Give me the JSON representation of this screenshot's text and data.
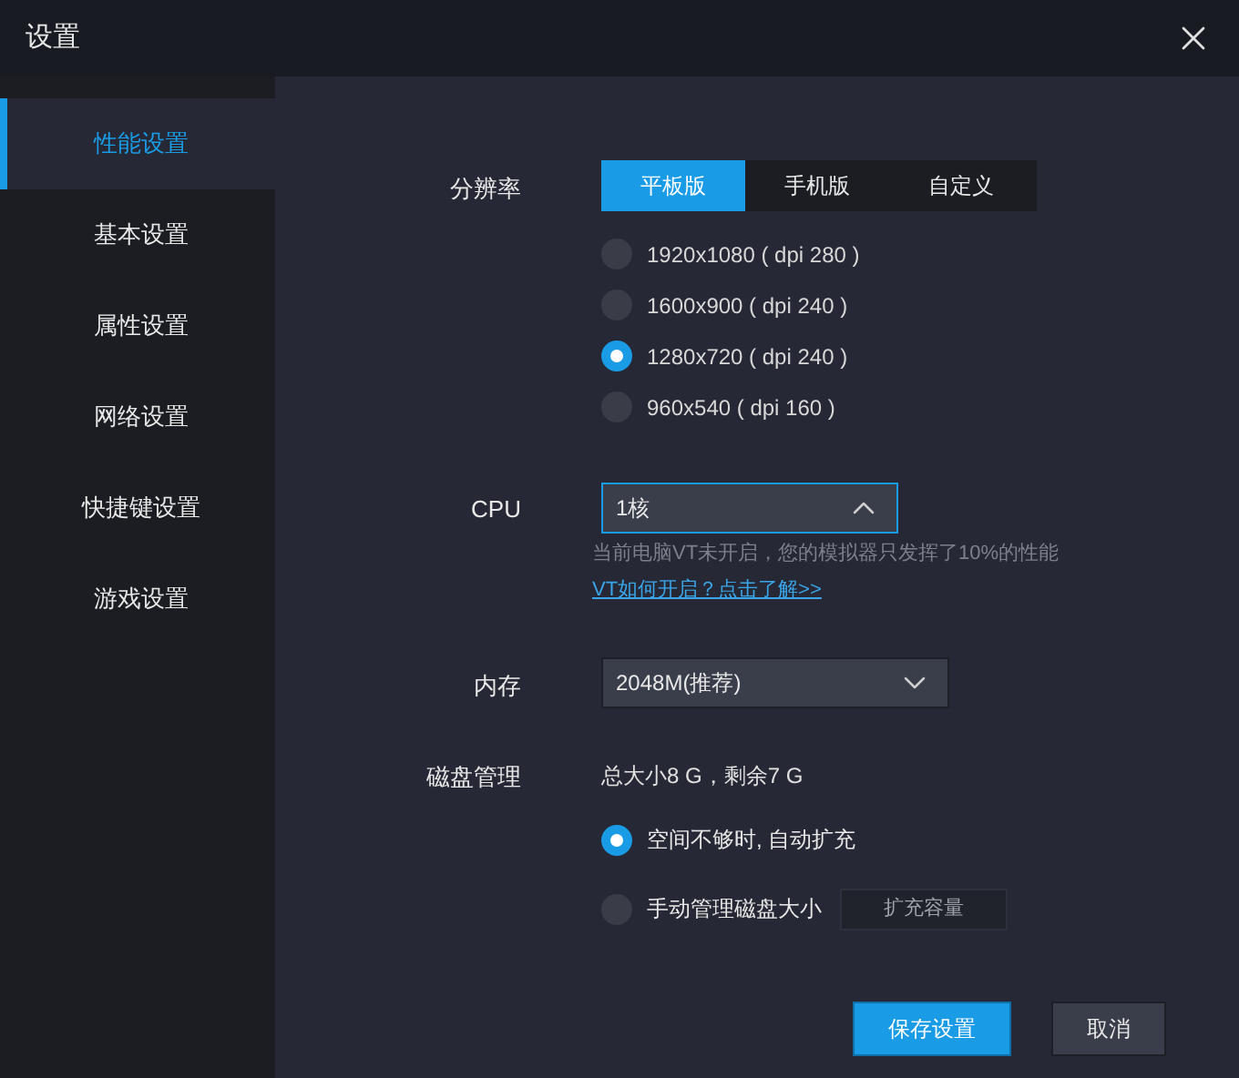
{
  "window": {
    "title": "设置"
  },
  "sidebar": {
    "items": [
      {
        "label": "性能设置",
        "selected": true
      },
      {
        "label": "基本设置",
        "selected": false
      },
      {
        "label": "属性设置",
        "selected": false
      },
      {
        "label": "网络设置",
        "selected": false
      },
      {
        "label": "快捷键设置",
        "selected": false
      },
      {
        "label": "游戏设置",
        "selected": false
      }
    ]
  },
  "resolution": {
    "label": "分辨率",
    "tabs": [
      {
        "label": "平板版",
        "selected": true
      },
      {
        "label": "手机版",
        "selected": false
      },
      {
        "label": "自定义",
        "selected": false
      }
    ],
    "options": [
      {
        "label": "1920x1080 ( dpi 280 )",
        "selected": false
      },
      {
        "label": "1600x900 ( dpi 240 )",
        "selected": false
      },
      {
        "label": "1280x720 ( dpi 240 )",
        "selected": true
      },
      {
        "label": "960x540 ( dpi 160 )",
        "selected": false
      }
    ]
  },
  "cpu": {
    "label": "CPU",
    "value": "1核",
    "expanded": true,
    "hint": "当前电脑VT未开启，您的模拟器只发挥了10%的性能",
    "link": "VT如何开启？点击了解>>"
  },
  "memory": {
    "label": "内存",
    "value": "2048M(推荐)",
    "expanded": false
  },
  "disk": {
    "label": "磁盘管理",
    "summary": "总大小8 G，剩余7 G",
    "options": [
      {
        "label": "空间不够时, 自动扩充",
        "selected": true
      },
      {
        "label": "手动管理磁盘大小",
        "selected": false
      }
    ],
    "expand_button": "扩充容量"
  },
  "buttons": {
    "save": "保存设置",
    "cancel": "取消"
  }
}
